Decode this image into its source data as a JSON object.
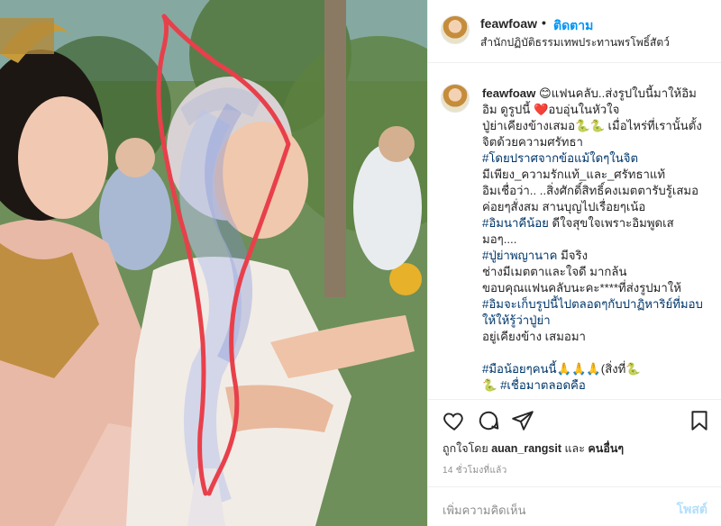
{
  "post": {
    "username": "feawfoaw",
    "follow_label": "ติดตาม",
    "dot": "•",
    "location": "สำนักปฏิบัติธรรมเทพประทานพรโพธิ์สัตว์"
  },
  "caption": {
    "username": "feawfoaw",
    "lines": [
      {
        "text": "😊แฟนคลับ..ส่งรูปใบนี้มาให้อิม",
        "tag": false
      },
      {
        "text": "อิม ดูรูปนี้ ❤️อบอุ่นในหัวใจ",
        "tag": false
      },
      {
        "text": "ปู่ย่าเคียงข้างเสมอ🐍🐍 เมื่อไหร่ที่เรานั้นตั้งจิตด้วยความศรัทธา",
        "tag": false
      },
      {
        "text": "#โดยปราศจากข้อแม้ใดๆในจิต",
        "tag": true
      },
      {
        "text": "มีเพียง_ความรักแท้_และ_ศรัทธาแท้",
        "tag": false
      },
      {
        "text": "อิมเชื่อว่า.. ..สิ่งศักดิ์สิทธิ์คงเมตตารับรู้เสมอ",
        "tag": false
      },
      {
        "text": "ค่อยๆสั่งสม สานบุญไปเรื่อยๆเน้อ",
        "tag": false
      },
      {
        "text": "#อิมนาคีน้อย",
        "tag": true,
        "after": " ดีใจสุขใจเพราะอิมพูดเสมอๆ.... "
      },
      {
        "text": "#ปู่ย่าพญานาค",
        "tag": true,
        "after": " มีจริง"
      },
      {
        "text": "ช่างมีเมตตาและใจดี มากล้น",
        "tag": false
      },
      {
        "text": "ขอบคุณแฟนคลับนะคะ****ที่ส่งรูปมาให้",
        "tag": false
      },
      {
        "text": "#อิมจะเก็บรูปนี้ไปตลอดๆกับปาฏิหาริย์ที่มอบให้ให้รู้ว่าปู่ย่า",
        "tag": true
      },
      {
        "text": "อยู่เคียงข้าง เสมอมา",
        "tag": false
      },
      {
        "text": "",
        "tag": false
      },
      {
        "text": "#มือน้อยๆคนนี้",
        "tag": true,
        "after": "🙏🙏🙏(สิ่งที่🐍"
      },
      {
        "text": "🐍 #เชื่อมาตลอดคือ",
        "tag": true
      }
    ]
  },
  "likes": {
    "prefix": "ถูกใจโดย ",
    "user": "auan_rangsit",
    "middle": " และ ",
    "others": "คนอื่นๆ"
  },
  "time": "14 ชั่วโมงที่แล้ว",
  "comment": {
    "placeholder": "เพิ่มความคิดเห็น",
    "post_label": "โพสต์"
  },
  "icons": {
    "like": "heart-icon",
    "comment": "comment-icon",
    "share": "share-icon",
    "save": "bookmark-icon"
  },
  "colors": {
    "link": "#0095f6",
    "hashtag": "#00376b",
    "annotation": "#e8404b"
  }
}
